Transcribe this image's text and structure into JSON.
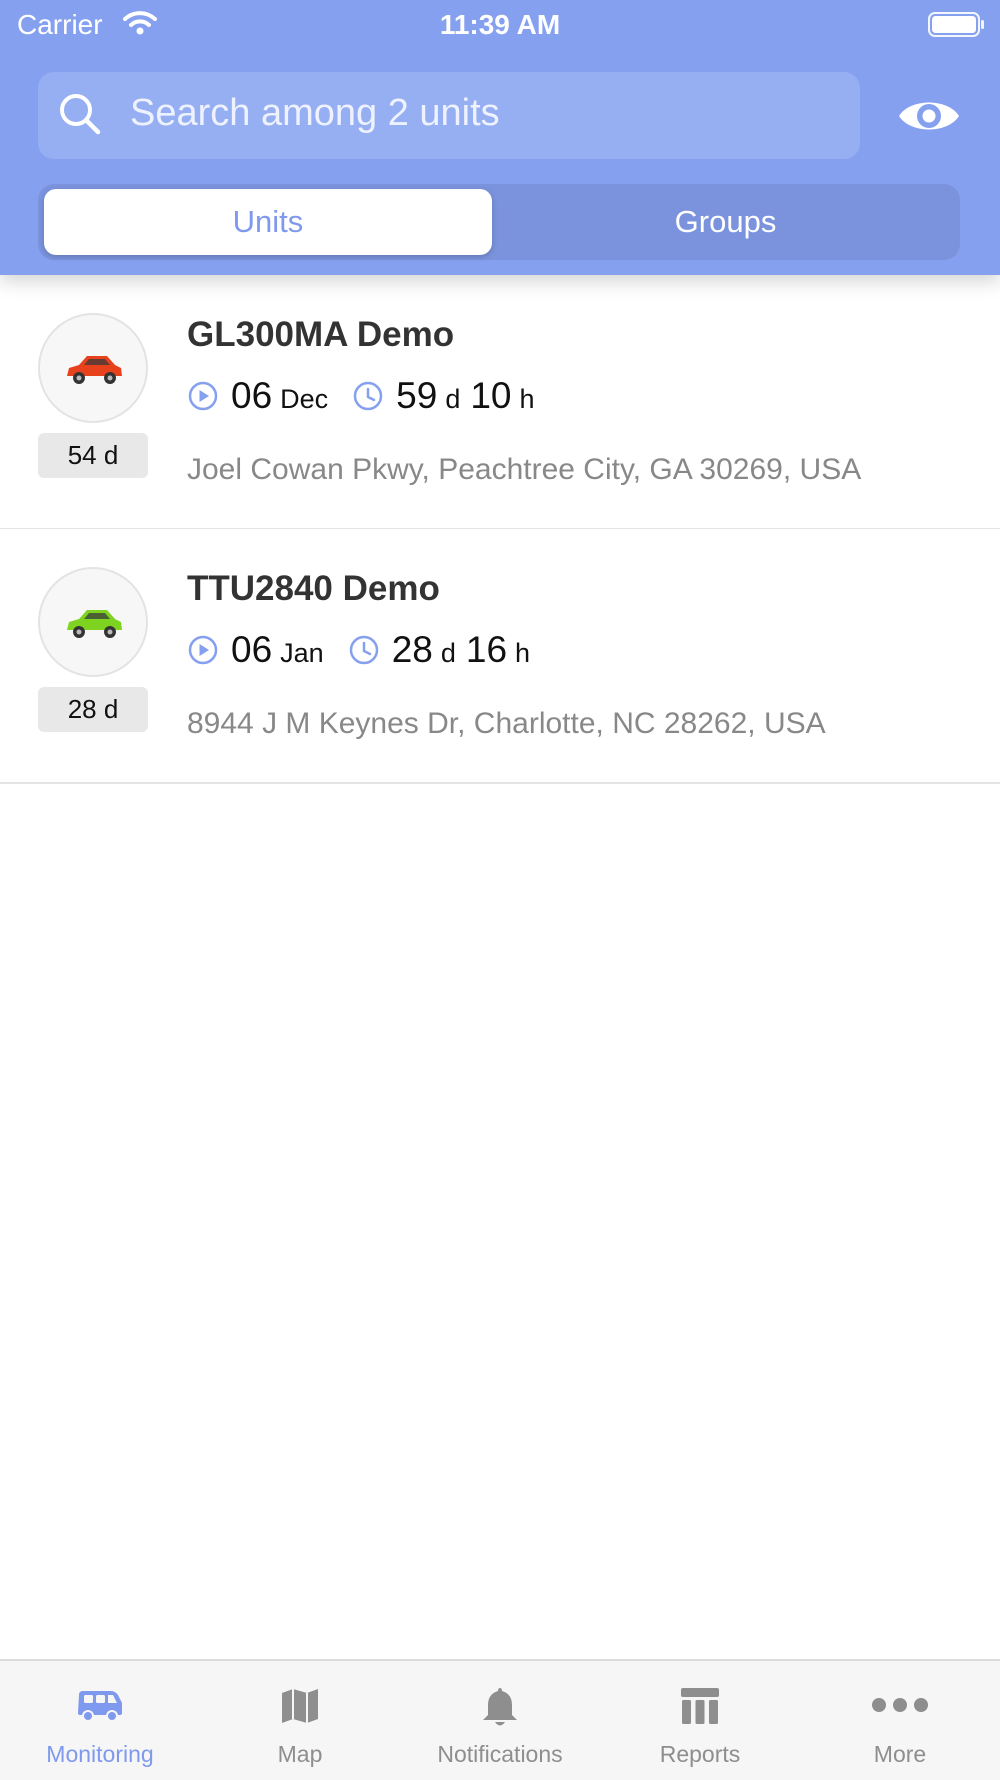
{
  "status_bar": {
    "carrier": "Carrier",
    "time": "11:39 AM"
  },
  "search": {
    "placeholder": "Search among 2 units"
  },
  "segments": {
    "units": "Units",
    "groups": "Groups"
  },
  "units": [
    {
      "name": "GL300MA Demo",
      "car_color": "#e8421c",
      "age": "54 d",
      "last_msg_day": "06",
      "last_msg_month": "Dec",
      "duration_days": "59",
      "duration_d_unit": "d",
      "duration_hours": "10",
      "duration_h_unit": "h",
      "address": "Joel Cowan Pkwy, Peachtree City, GA 30269, USA"
    },
    {
      "name": "TTU2840 Demo",
      "car_color": "#7ed321",
      "age": "28 d",
      "last_msg_day": "06",
      "last_msg_month": "Jan",
      "duration_days": "28",
      "duration_d_unit": "d",
      "duration_hours": "16",
      "duration_h_unit": "h",
      "address": "8944 J M Keynes Dr, Charlotte, NC 28262, USA"
    }
  ],
  "tabbar": [
    {
      "label": "Monitoring",
      "icon": "van-icon",
      "active": true
    },
    {
      "label": "Map",
      "icon": "map-icon",
      "active": false
    },
    {
      "label": "Notifications",
      "icon": "bell-icon",
      "active": false
    },
    {
      "label": "Reports",
      "icon": "reports-icon",
      "active": false
    },
    {
      "label": "More",
      "icon": "more-icon",
      "active": false
    }
  ],
  "colors": {
    "accent": "#86a0f0",
    "active_tab": "#7f99ee",
    "inactive_tab": "#8e8e8e"
  }
}
